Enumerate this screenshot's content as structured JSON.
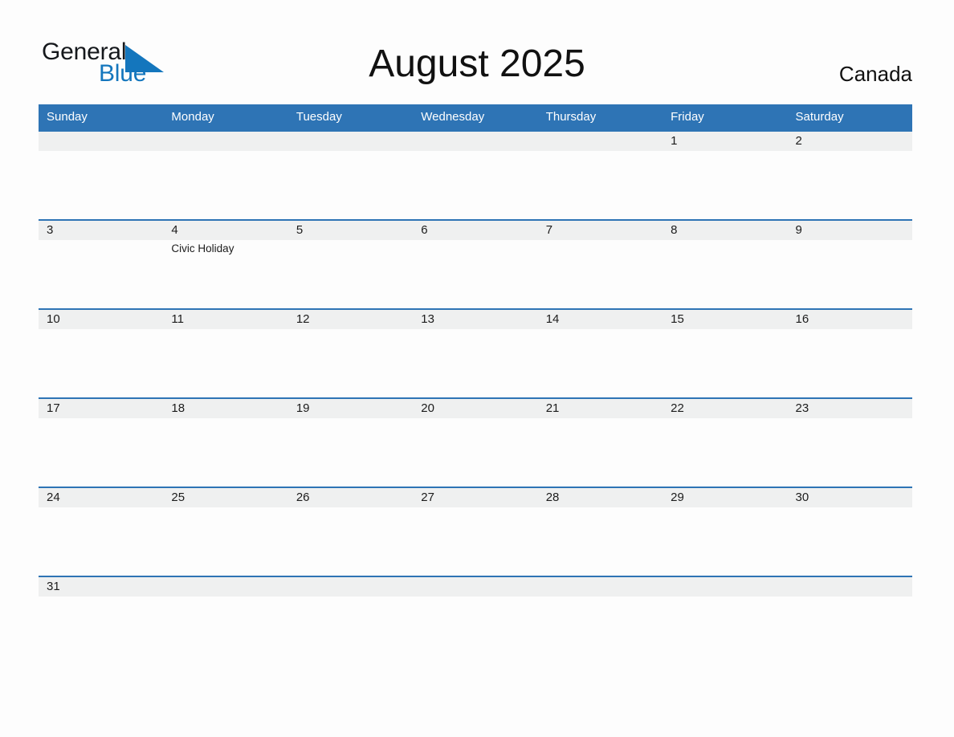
{
  "header": {
    "logo": {
      "word_one": "General",
      "word_two": "Blue",
      "triangle_color": "#1476bd",
      "text_color_one": "#15181c",
      "text_color_two": "#1476bd"
    },
    "title": "August 2025",
    "region": "Canada"
  },
  "calendar": {
    "accent_color": "#2e74b5",
    "band_color": "#eff0f0",
    "month": "August",
    "year": "2025",
    "weekday_headers": [
      "Sunday",
      "Monday",
      "Tuesday",
      "Wednesday",
      "Thursday",
      "Friday",
      "Saturday"
    ],
    "weeks": [
      [
        {
          "day": "",
          "events": []
        },
        {
          "day": "",
          "events": []
        },
        {
          "day": "",
          "events": []
        },
        {
          "day": "",
          "events": []
        },
        {
          "day": "",
          "events": []
        },
        {
          "day": "1",
          "events": []
        },
        {
          "day": "2",
          "events": []
        }
      ],
      [
        {
          "day": "3",
          "events": []
        },
        {
          "day": "4",
          "events": [
            "Civic Holiday"
          ]
        },
        {
          "day": "5",
          "events": []
        },
        {
          "day": "6",
          "events": []
        },
        {
          "day": "7",
          "events": []
        },
        {
          "day": "8",
          "events": []
        },
        {
          "day": "9",
          "events": []
        }
      ],
      [
        {
          "day": "10",
          "events": []
        },
        {
          "day": "11",
          "events": []
        },
        {
          "day": "12",
          "events": []
        },
        {
          "day": "13",
          "events": []
        },
        {
          "day": "14",
          "events": []
        },
        {
          "day": "15",
          "events": []
        },
        {
          "day": "16",
          "events": []
        }
      ],
      [
        {
          "day": "17",
          "events": []
        },
        {
          "day": "18",
          "events": []
        },
        {
          "day": "19",
          "events": []
        },
        {
          "day": "20",
          "events": []
        },
        {
          "day": "21",
          "events": []
        },
        {
          "day": "22",
          "events": []
        },
        {
          "day": "23",
          "events": []
        }
      ],
      [
        {
          "day": "24",
          "events": []
        },
        {
          "day": "25",
          "events": []
        },
        {
          "day": "26",
          "events": []
        },
        {
          "day": "27",
          "events": []
        },
        {
          "day": "28",
          "events": []
        },
        {
          "day": "29",
          "events": []
        },
        {
          "day": "30",
          "events": []
        }
      ],
      [
        {
          "day": "31",
          "events": []
        },
        {
          "day": "",
          "events": []
        },
        {
          "day": "",
          "events": []
        },
        {
          "day": "",
          "events": []
        },
        {
          "day": "",
          "events": []
        },
        {
          "day": "",
          "events": []
        },
        {
          "day": "",
          "events": []
        }
      ]
    ]
  }
}
